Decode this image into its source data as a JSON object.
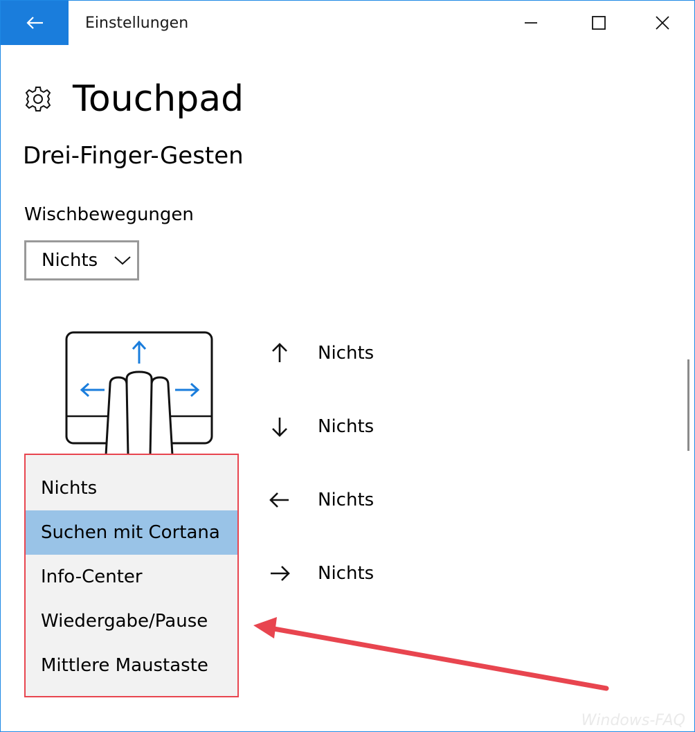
{
  "window": {
    "title": "Einstellungen",
    "accent_color": "#1a7ddc",
    "controls": {
      "minimize": "minimize-icon",
      "maximize": "maximize-icon",
      "close": "close-icon"
    }
  },
  "page": {
    "title": "Touchpad",
    "icon": "gear-icon",
    "section": "Drei-Finger-Gesten",
    "swipe_label": "Wischbewegungen",
    "swipe_value": "Nichts"
  },
  "gestures": [
    {
      "direction": "up",
      "value": "Nichts"
    },
    {
      "direction": "down",
      "value": "Nichts"
    },
    {
      "direction": "left",
      "value": "Nichts"
    },
    {
      "direction": "right",
      "value": "Nichts"
    }
  ],
  "menu": {
    "items": [
      "Nichts",
      "Suchen mit Cortana",
      "Info-Center",
      "Wiedergabe/Pause",
      "Mittlere Maustaste"
    ],
    "selected": "Suchen mit Cortana",
    "highlight_color": "#99c3e7",
    "annotation_color": "#e8454f"
  },
  "watermark": "Windows-FAQ"
}
